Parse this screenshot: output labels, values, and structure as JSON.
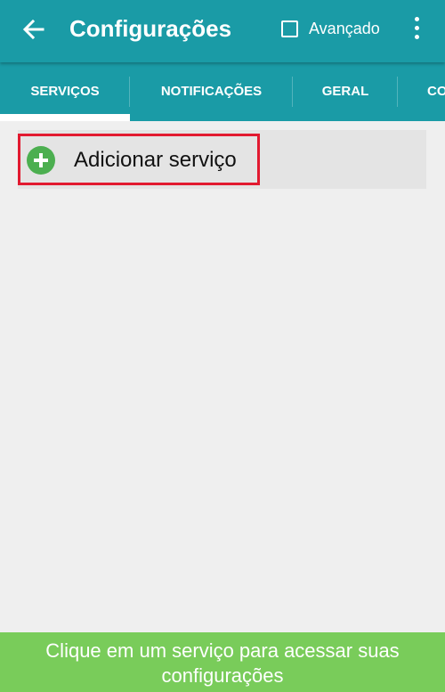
{
  "appbar": {
    "title": "Configurações",
    "advanced_label": "Avançado",
    "advanced_checked": false,
    "background_color": "#1a9ba6",
    "icons": [
      "back-arrow-icon",
      "checkbox-icon",
      "more-vert-icon"
    ]
  },
  "tabs": [
    {
      "label": "SERVIÇOS",
      "selected": true
    },
    {
      "label": "NOTIFICAÇÕES",
      "selected": false
    },
    {
      "label": "GERAL",
      "selected": false
    },
    {
      "label": "CO",
      "selected": false
    }
  ],
  "content": {
    "add_service_label": "Adicionar serviço",
    "add_icon": "plus-circle-icon",
    "add_icon_color": "#4caf50",
    "highlight_color": "#e21a30"
  },
  "footer": {
    "message": "Clique em um serviço para acessar suas configurações",
    "background_color": "#79cc5a"
  }
}
